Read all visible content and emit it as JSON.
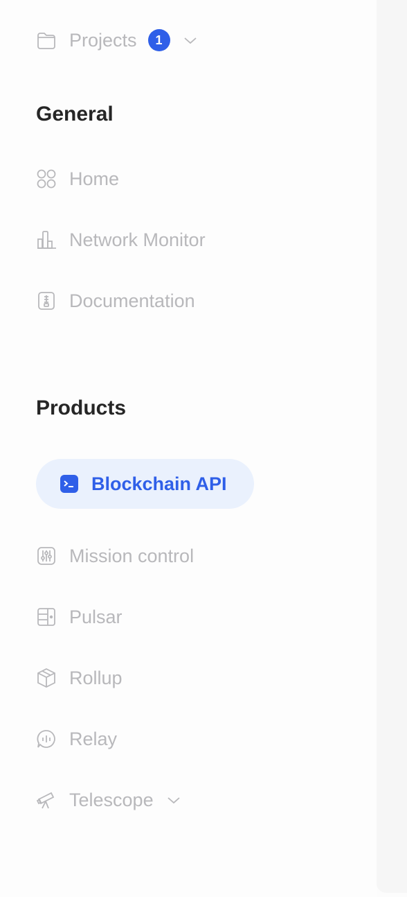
{
  "projects": {
    "label": "Projects",
    "badge": "1"
  },
  "general": {
    "title": "General",
    "items": [
      {
        "label": "Home",
        "icon": "grid-circles-icon"
      },
      {
        "label": "Network Monitor",
        "icon": "bar-chart-icon"
      },
      {
        "label": "Documentation",
        "icon": "document-icon"
      }
    ]
  },
  "products": {
    "title": "Products",
    "active": {
      "label": "Blockchain API",
      "icon": "terminal-icon"
    },
    "items": [
      {
        "label": "Mission control",
        "icon": "sliders-icon"
      },
      {
        "label": "Pulsar",
        "icon": "stack-icon"
      },
      {
        "label": "Rollup",
        "icon": "cube-icon"
      },
      {
        "label": "Relay",
        "icon": "chat-wave-icon"
      },
      {
        "label": "Telescope",
        "icon": "telescope-icon"
      }
    ]
  },
  "colors": {
    "accent": "#2f5fe8",
    "active_bg": "#eaf1fd",
    "muted_text": "#b8b8bb",
    "heading": "#262626"
  }
}
